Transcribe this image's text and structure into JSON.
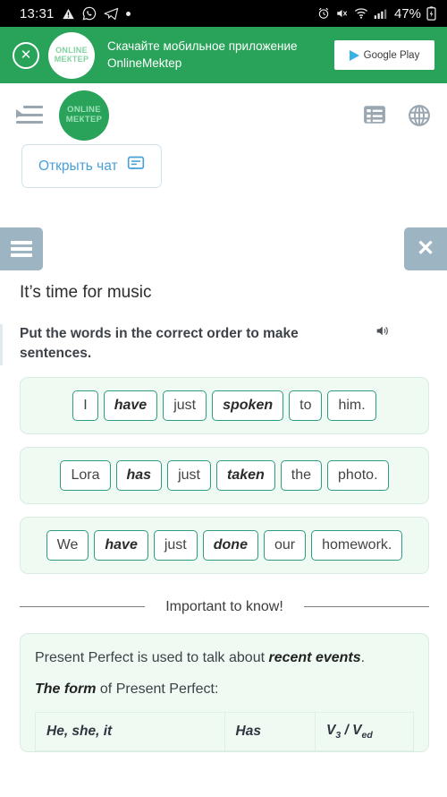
{
  "statusbar": {
    "time": "13:31",
    "left_icons": [
      "warning-triangle-icon",
      "whatsapp-icon",
      "telegram-icon",
      "dot-icon"
    ],
    "right_icons": [
      "alarm-icon",
      "mute-vibrate-icon",
      "wifi-icon",
      "signal-icon"
    ],
    "battery_percent": "47%",
    "battery_icon": "battery-charging-icon"
  },
  "ad": {
    "close_icon": "close-circle-icon",
    "logo_line1": "ONLINE",
    "logo_line2": "МЕКТЕР",
    "text_line1": "Скачайте мобильное приложение",
    "text_line2": "OnlineMektep",
    "button_label": "Google Play",
    "background": "#2aa35a"
  },
  "navbar": {
    "menu_icon": "menu-collapse-icon",
    "logo_line1": "ONLINE",
    "logo_line2": "МЕКТЕР",
    "list_icon": "list-icon",
    "globe_icon": "globe-icon"
  },
  "chat": {
    "label": "Открыть чат",
    "icon": "chat-bubble-icon"
  },
  "lessonbar": {
    "menu_icon": "hamburger-icon",
    "close_icon": "close-icon"
  },
  "lesson": {
    "title": "It’s time for music",
    "task": "Put the words in the correct order to make sentences.",
    "audio_icon": "speaker-icon"
  },
  "sentences": [
    {
      "tiles": [
        {
          "text": "I",
          "bold": false
        },
        {
          "text": "have",
          "bold": true
        },
        {
          "text": "just",
          "bold": false
        },
        {
          "text": "spoken",
          "bold": true
        },
        {
          "text": "to",
          "bold": false
        },
        {
          "text": "him.",
          "bold": false
        }
      ]
    },
    {
      "tiles": [
        {
          "text": "Lora",
          "bold": false
        },
        {
          "text": "has",
          "bold": true
        },
        {
          "text": "just",
          "bold": false
        },
        {
          "text": "taken",
          "bold": true
        },
        {
          "text": "the",
          "bold": false
        },
        {
          "text": "photo.",
          "bold": false
        }
      ]
    },
    {
      "tiles": [
        {
          "text": "We",
          "bold": false
        },
        {
          "text": "have",
          "bold": true
        },
        {
          "text": "just",
          "bold": false
        },
        {
          "text": "done",
          "bold": true
        },
        {
          "text": "our",
          "bold": false
        },
        {
          "text": "homework.",
          "bold": false
        }
      ]
    }
  ],
  "important": {
    "label": "Important to know!"
  },
  "info": {
    "line1_a": "Present Perfect is used to talk about ",
    "line1_b": "recent events",
    "line1_c": ".",
    "line2_a": "The form",
    "line2_b": " of Present Perfect:",
    "table_row": {
      "subject": "He, she, it",
      "auxiliary": "Has",
      "verb_v": "V",
      "verb_sub1": "3",
      "verb_sep": " / V",
      "verb_sub2": "ed"
    }
  },
  "colors": {
    "brand_green": "#2aa35a",
    "tile_border": "#2f9b82",
    "panel_bg": "#effaf3",
    "toolbar_btn": "#9db4c3",
    "chat_blue": "#49a0d8"
  }
}
